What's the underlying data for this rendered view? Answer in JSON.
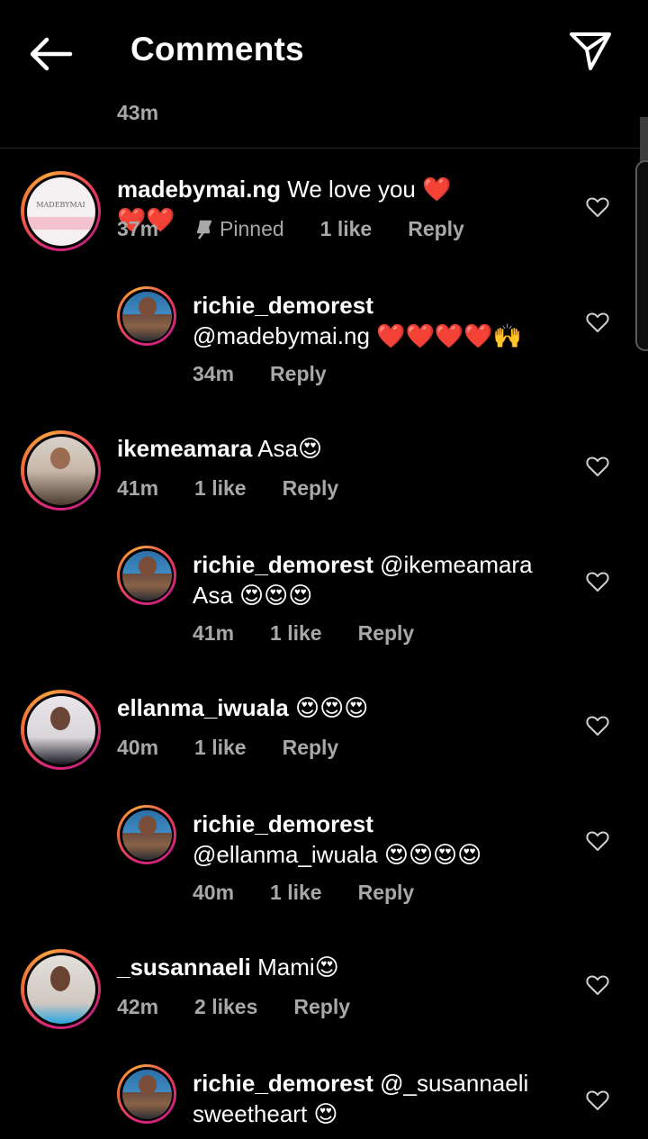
{
  "header": {
    "title": "Comments",
    "back_icon": "arrow-left-icon",
    "send_icon": "paper-plane-icon"
  },
  "top_time": "43m",
  "comments": [
    {
      "user": "madebymai.ng",
      "text": "We love you ❤️❤️❤️",
      "time": "37m",
      "pinned": "Pinned",
      "likes": "1 like",
      "reply": "Reply",
      "avatar_brand": "MADEBYMAI"
    },
    {
      "user": "richie_demorest",
      "text": "@madebymai.ng ❤️❤️❤️❤️🙌",
      "time": "34m",
      "likes": "",
      "reply": "Reply"
    },
    {
      "user": "ikemeamara",
      "text": "Asa😍",
      "time": "41m",
      "likes": "1 like",
      "reply": "Reply"
    },
    {
      "user": "richie_demorest",
      "text": "@ikemeamara Asa 😍😍😍",
      "time": "41m",
      "likes": "1 like",
      "reply": "Reply"
    },
    {
      "user": "ellanma_iwuala",
      "text": "😍😍😍",
      "time": "40m",
      "likes": "1 like",
      "reply": "Reply"
    },
    {
      "user": "richie_demorest",
      "text": "@ellanma_iwuala 😍😍😍😍",
      "time": "40m",
      "likes": "1 like",
      "reply": "Reply"
    },
    {
      "user": "_susannaeli",
      "text": "Mami😍",
      "time": "42m",
      "likes": "2 likes",
      "reply": "Reply"
    },
    {
      "user": "richie_demorest",
      "text": "@_susannaeli sweetheart 😍",
      "time": "",
      "likes": "",
      "reply": ""
    }
  ]
}
